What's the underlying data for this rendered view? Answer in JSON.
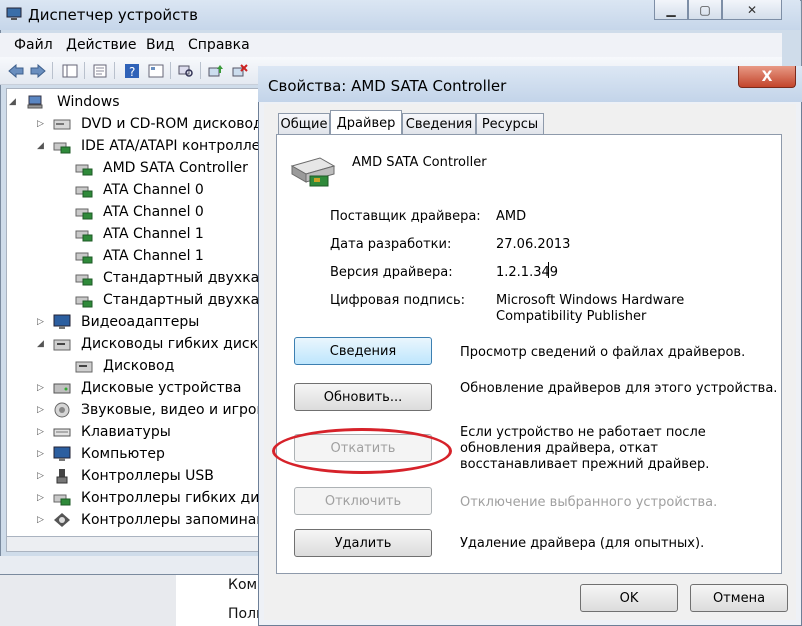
{
  "main_window": {
    "title": "Диспетчер устройств",
    "menu": [
      "Файл",
      "Действие",
      "Вид",
      "Справка"
    ],
    "tree": [
      {
        "label": "Windows",
        "level": 0,
        "expander": "open",
        "icon": "computer-icon"
      },
      {
        "label": "DVD и CD-ROM дисководы",
        "level": 1,
        "expander": "closed",
        "icon": "dvd-drive-icon"
      },
      {
        "label": "IDE ATA/ATAPI контроллеры",
        "level": 1,
        "expander": "open",
        "icon": "controller-icon"
      },
      {
        "label": "AMD SATA Controller",
        "level": 2,
        "expander": "none",
        "icon": "controller-icon"
      },
      {
        "label": "ATA Channel 0",
        "level": 2,
        "expander": "none",
        "icon": "controller-icon"
      },
      {
        "label": "ATA Channel 0",
        "level": 2,
        "expander": "none",
        "icon": "controller-icon"
      },
      {
        "label": "ATA Channel 1",
        "level": 2,
        "expander": "none",
        "icon": "controller-icon"
      },
      {
        "label": "ATA Channel 1",
        "level": 2,
        "expander": "none",
        "icon": "controller-icon"
      },
      {
        "label": "Стандартный двухканальный",
        "level": 2,
        "expander": "none",
        "icon": "controller-icon"
      },
      {
        "label": "Стандартный двухканальный",
        "level": 2,
        "expander": "none",
        "icon": "controller-icon"
      },
      {
        "label": "Видеоадаптеры",
        "level": 1,
        "expander": "closed",
        "icon": "monitor-icon"
      },
      {
        "label": "Дисководы гибких дисков",
        "level": 1,
        "expander": "open",
        "icon": "floppy-drive-icon"
      },
      {
        "label": "Дисковод",
        "level": 2,
        "expander": "none",
        "icon": "floppy-drive-icon"
      },
      {
        "label": "Дисковые устройства",
        "level": 1,
        "expander": "closed",
        "icon": "disk-drive-icon"
      },
      {
        "label": "Звуковые, видео и игровые",
        "level": 1,
        "expander": "closed",
        "icon": "speaker-icon"
      },
      {
        "label": "Клавиатуры",
        "level": 1,
        "expander": "closed",
        "icon": "keyboard-icon"
      },
      {
        "label": "Компьютер",
        "level": 1,
        "expander": "closed",
        "icon": "monitor-icon"
      },
      {
        "label": "Контроллеры USB",
        "level": 1,
        "expander": "closed",
        "icon": "usb-icon"
      },
      {
        "label": "Контроллеры гибких дисков",
        "level": 1,
        "expander": "closed",
        "icon": "controller-icon"
      },
      {
        "label": "Контроллеры запоминающих",
        "level": 1,
        "expander": "closed",
        "icon": "storage-controller-icon"
      }
    ]
  },
  "background_text": [
    "Комп",
    "Полн"
  ],
  "dialog": {
    "title": "Свойства: AMD SATA Controller",
    "close_label": "X",
    "tabs": [
      "Общие",
      "Драйвер",
      "Сведения",
      "Ресурсы"
    ],
    "device_name": "AMD SATA Controller",
    "fields": [
      {
        "label": "Поставщик драйвера:",
        "value": "AMD"
      },
      {
        "label": "Дата разработки:",
        "value": "27.06.2013"
      },
      {
        "label": "Версия драйвера:",
        "value": "1.2.1.349"
      },
      {
        "label": "Цифровая подпись:",
        "value": "Microsoft Windows Hardware Compatibility Publisher"
      }
    ],
    "actions": [
      {
        "button": "Сведения",
        "description": "Просмотр сведений о файлах драйверов.",
        "state": "focused"
      },
      {
        "button": "Обновить...",
        "description": "Обновление драйверов для этого устройства.",
        "state": "normal"
      },
      {
        "button": "Откатить",
        "description": "Если устройство не работает после обновления драйвера, откат восстанавливает прежний драйвер.",
        "state": "disabled"
      },
      {
        "button": "Отключить",
        "description": "Отключение выбранного устройства.",
        "state": "disabled"
      },
      {
        "button": "Удалить",
        "description": "Удаление драйвера (для опытных).",
        "state": "normal"
      }
    ],
    "ok_label": "OK",
    "cancel_label": "Отмена"
  },
  "colors": {
    "annotation_oval": "#d6222a",
    "window_frame": "#cfdcea"
  }
}
